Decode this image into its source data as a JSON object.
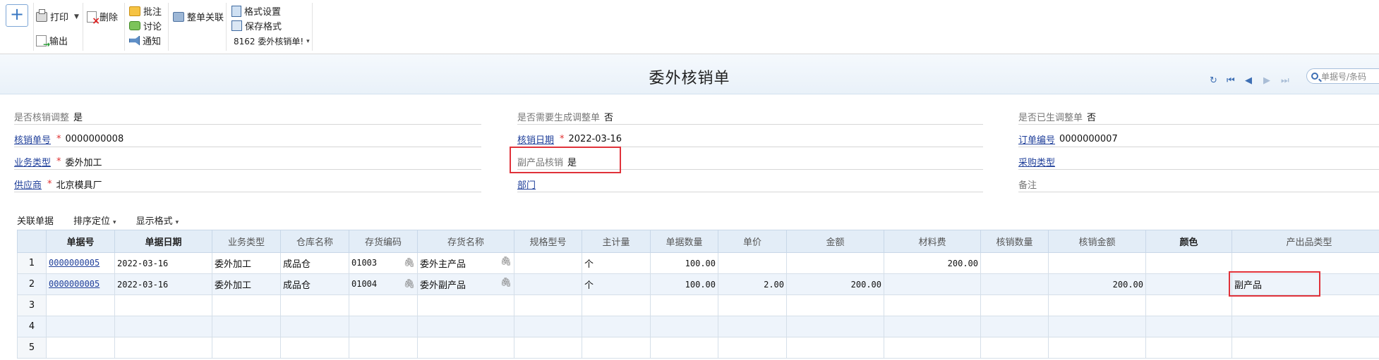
{
  "toolbar": {
    "add": "+",
    "print": "打印",
    "delete": "删除",
    "export": "输出",
    "annotate": "批注",
    "discuss": "讨论",
    "notify": "通知",
    "link_all": "整单关联",
    "format_settings": "格式设置",
    "save_format": "保存格式",
    "template": "8162 委外核销单!"
  },
  "title": "委外核销单",
  "nav": {
    "refresh": "↻",
    "first": "⏮",
    "prev": "◀",
    "next": "▶",
    "last": "⏭"
  },
  "search": {
    "placeholder": "单据号/条码"
  },
  "form": {
    "verify_adjust": {
      "label": "是否核销调整",
      "value": "是"
    },
    "need_adjust": {
      "label": "是否需要生成调整单",
      "value": "否"
    },
    "adjusted": {
      "label": "是否已生调整单",
      "value": "否"
    },
    "verify_no": {
      "label": "核销单号",
      "value": "0000000008"
    },
    "verify_date": {
      "label": "核销日期",
      "value": "2022-03-16"
    },
    "order_no": {
      "label": "订单编号",
      "value": "0000000007"
    },
    "biz_type": {
      "label": "业务类型",
      "value": "委外加工"
    },
    "byproduct": {
      "label": "副产品核销",
      "value": "是"
    },
    "purchase_type": {
      "label": "采购类型",
      "value": ""
    },
    "supplier": {
      "label": "供应商",
      "value": "北京模具厂"
    },
    "dept": {
      "label": "部门",
      "value": ""
    },
    "remark": {
      "label": "备注",
      "value": ""
    },
    "required_mark": "*"
  },
  "grid": {
    "tools": {
      "related": "关联单据",
      "sort": "排序定位",
      "display": "显示格式"
    },
    "headers": [
      "单据号",
      "单据日期",
      "业务类型",
      "仓库名称",
      "存货编码",
      "存货名称",
      "规格型号",
      "主计量",
      "单据数量",
      "单价",
      "金额",
      "材料费",
      "核销数量",
      "核销金额",
      "颜色",
      "产出品类型"
    ],
    "rows": [
      {
        "n": "1",
        "doc": "0000000005",
        "date": "2022-03-16",
        "biz": "委外加工",
        "wh": "成品仓",
        "code": "01003",
        "name": "委外主产品",
        "spec": "",
        "unit": "个",
        "qty": "100.00",
        "price": "",
        "amount": "",
        "material": "200.00",
        "vqty": "",
        "vamount": "",
        "color": "",
        "ptype": ""
      },
      {
        "n": "2",
        "doc": "0000000005",
        "date": "2022-03-16",
        "biz": "委外加工",
        "wh": "成品仓",
        "code": "01004",
        "name": "委外副产品",
        "spec": "",
        "unit": "个",
        "qty": "100.00",
        "price": "2.00",
        "amount": "200.00",
        "material": "",
        "vqty": "",
        "vamount": "200.00",
        "color": "",
        "ptype": "副产品"
      },
      {
        "n": "3"
      },
      {
        "n": "4"
      },
      {
        "n": "5"
      }
    ]
  }
}
